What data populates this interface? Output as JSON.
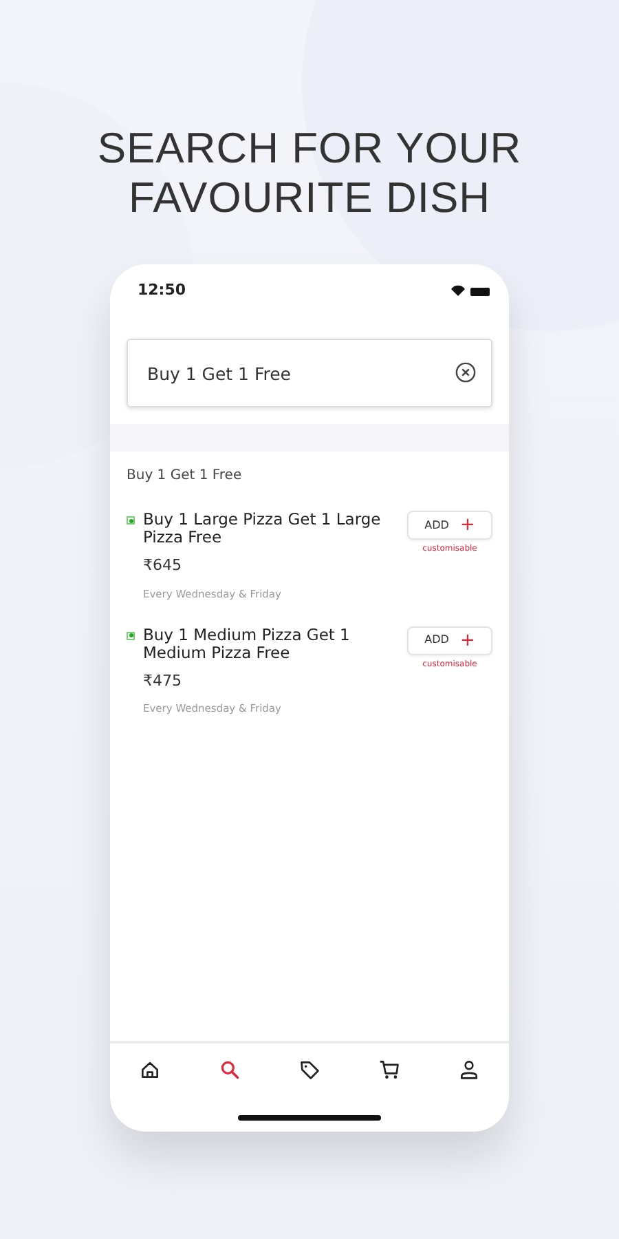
{
  "headline": "SEARCH FOR YOUR FAVOURITE DISH",
  "status_bar": {
    "time": "12:50"
  },
  "search": {
    "value": "Buy 1 Get 1 Free"
  },
  "section_title": "Buy 1 Get 1 Free",
  "items": [
    {
      "name": "Buy 1 Large Pizza Get 1 Large Pizza Free",
      "veg": true,
      "price": "₹645",
      "note": "Every Wednesday & Friday",
      "button": "ADD",
      "button_icon": "+",
      "customisable": "customisable"
    },
    {
      "name": "Buy 1 Medium Pizza Get 1 Medium Pizza Free",
      "veg": true,
      "price": "₹475",
      "note": "Every Wednesday & Friday",
      "button": "ADD",
      "button_icon": "+",
      "customisable": "customisable"
    }
  ],
  "bottom_nav": [
    {
      "kind": "home",
      "selected": false
    },
    {
      "kind": "search",
      "selected": true
    },
    {
      "kind": "offers",
      "selected": false
    },
    {
      "kind": "cart",
      "selected": false
    },
    {
      "kind": "profile",
      "selected": false
    }
  ]
}
